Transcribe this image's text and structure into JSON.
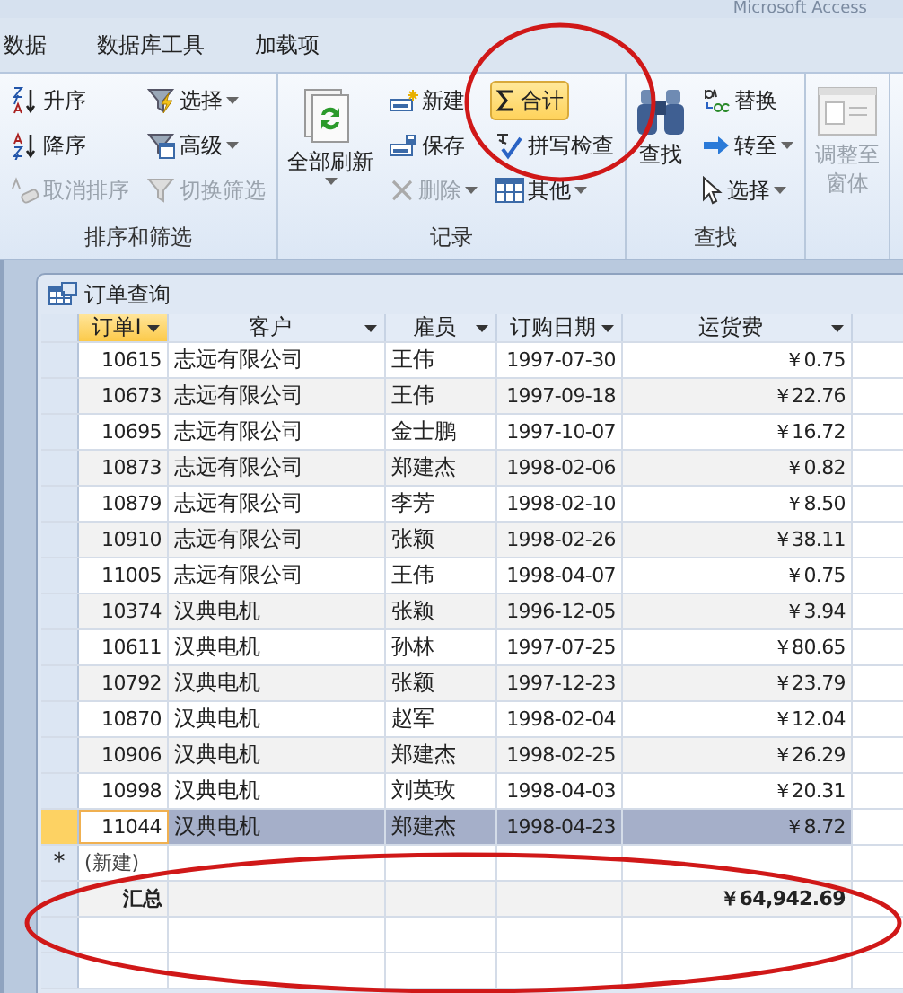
{
  "app_title": "Microsoft Access",
  "tabs": [
    {
      "label": "数据",
      "selected": false
    },
    {
      "label": "数据库工具",
      "selected": false
    },
    {
      "label": "加载项",
      "selected": false
    }
  ],
  "ribbon_groups": [
    {
      "label": "排序和筛选",
      "columns": [
        [
          {
            "label": "升序",
            "kind": "small",
            "disabled": false,
            "dropdown": false,
            "selected": false
          },
          {
            "label": "降序",
            "kind": "small",
            "disabled": false,
            "dropdown": false,
            "selected": false
          },
          {
            "label": "取消排序",
            "kind": "small",
            "disabled": true,
            "dropdown": false,
            "selected": false
          }
        ],
        [
          {
            "label": "选择",
            "kind": "small",
            "disabled": false,
            "dropdown": true,
            "selected": false
          },
          {
            "label": "高级",
            "kind": "small",
            "disabled": false,
            "dropdown": true,
            "selected": false
          },
          {
            "label": "切换筛选",
            "kind": "small",
            "disabled": true,
            "dropdown": false,
            "selected": false
          }
        ]
      ]
    },
    {
      "label": "记录",
      "columns": [
        [
          {
            "label": "全部刷新",
            "kind": "large",
            "disabled": false,
            "dropdown": true,
            "selected": false
          }
        ],
        [
          {
            "label": "新建",
            "kind": "small",
            "disabled": false,
            "dropdown": false,
            "selected": false
          },
          {
            "label": "保存",
            "kind": "small",
            "disabled": false,
            "dropdown": false,
            "selected": false
          },
          {
            "label": "删除",
            "kind": "small",
            "disabled": true,
            "dropdown": true,
            "selected": false
          }
        ],
        [
          {
            "label": "合计",
            "kind": "small",
            "disabled": false,
            "dropdown": false,
            "selected": true
          },
          {
            "label": "拼写检查",
            "kind": "small",
            "disabled": false,
            "dropdown": false,
            "selected": false
          },
          {
            "label": "其他",
            "kind": "small",
            "disabled": false,
            "dropdown": true,
            "selected": false
          }
        ]
      ]
    },
    {
      "label": "查找",
      "columns": [
        [
          {
            "label": "查找",
            "kind": "large",
            "disabled": false,
            "dropdown": false,
            "selected": false
          }
        ],
        [
          {
            "label": "替换",
            "kind": "small",
            "disabled": false,
            "dropdown": false,
            "selected": false
          },
          {
            "label": "转至",
            "kind": "small",
            "disabled": false,
            "dropdown": true,
            "selected": false
          },
          {
            "label": "选择",
            "kind": "small",
            "disabled": false,
            "dropdown": true,
            "selected": false
          }
        ]
      ]
    },
    {
      "columns": [
        [
          {
            "label": "调整至",
            "label_2": "窗体",
            "kind": "large",
            "disabled": true,
            "dropdown": false,
            "selected": false
          }
        ]
      ]
    }
  ],
  "document": {
    "title": "订单查询",
    "columns": [
      {
        "label": "订单I",
        "selected": true
      },
      {
        "label": "客户",
        "selected": false
      },
      {
        "label": "雇员",
        "selected": false
      },
      {
        "label": "订购日期",
        "selected": false
      },
      {
        "label": "运货费",
        "selected": false
      }
    ],
    "rows": [
      {
        "id": "10615",
        "customer": "志远有限公司",
        "employee": "王伟",
        "date": "1997-07-30",
        "freight": "￥0.75",
        "selected": false
      },
      {
        "id": "10673",
        "customer": "志远有限公司",
        "employee": "王伟",
        "date": "1997-09-18",
        "freight": "￥22.76",
        "selected": false
      },
      {
        "id": "10695",
        "customer": "志远有限公司",
        "employee": "金士鹏",
        "date": "1997-10-07",
        "freight": "￥16.72",
        "selected": false
      },
      {
        "id": "10873",
        "customer": "志远有限公司",
        "employee": "郑建杰",
        "date": "1998-02-06",
        "freight": "￥0.82",
        "selected": false
      },
      {
        "id": "10879",
        "customer": "志远有限公司",
        "employee": "李芳",
        "date": "1998-02-10",
        "freight": "￥8.50",
        "selected": false
      },
      {
        "id": "10910",
        "customer": "志远有限公司",
        "employee": "张颖",
        "date": "1998-02-26",
        "freight": "￥38.11",
        "selected": false
      },
      {
        "id": "11005",
        "customer": "志远有限公司",
        "employee": "王伟",
        "date": "1998-04-07",
        "freight": "￥0.75",
        "selected": false
      },
      {
        "id": "10374",
        "customer": "汉典电机",
        "employee": "张颖",
        "date": "1996-12-05",
        "freight": "￥3.94",
        "selected": false
      },
      {
        "id": "10611",
        "customer": "汉典电机",
        "employee": "孙林",
        "date": "1997-07-25",
        "freight": "￥80.65",
        "selected": false
      },
      {
        "id": "10792",
        "customer": "汉典电机",
        "employee": "张颖",
        "date": "1997-12-23",
        "freight": "￥23.79",
        "selected": false
      },
      {
        "id": "10870",
        "customer": "汉典电机",
        "employee": "赵军",
        "date": "1998-02-04",
        "freight": "￥12.04",
        "selected": false
      },
      {
        "id": "10906",
        "customer": "汉典电机",
        "employee": "郑建杰",
        "date": "1998-02-25",
        "freight": "￥26.29",
        "selected": false
      },
      {
        "id": "10998",
        "customer": "汉典电机",
        "employee": "刘英玫",
        "date": "1998-04-03",
        "freight": "￥20.31",
        "selected": false
      },
      {
        "id": "11044",
        "customer": "汉典电机",
        "employee": "郑建杰",
        "date": "1998-04-23",
        "freight": "￥8.72",
        "selected": true
      }
    ],
    "new_row": {
      "marker": "*",
      "label": "(新建)"
    },
    "total_row": {
      "label": "汇总",
      "freight_total": "￥64,942.69"
    }
  }
}
